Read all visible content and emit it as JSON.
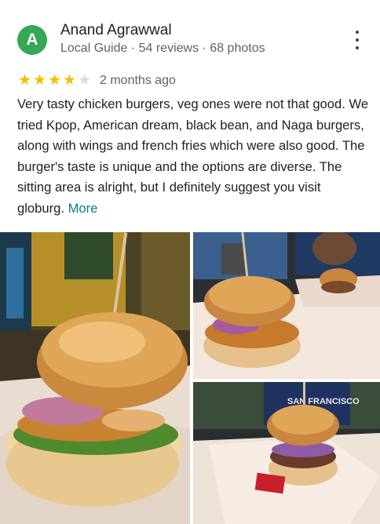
{
  "reviewer": {
    "avatar_letter": "A",
    "avatar_color": "#34a853",
    "name": "Anand Agrawwal",
    "meta": "Local Guide · 54 reviews · 68 photos"
  },
  "review": {
    "rating": 4,
    "max_rating": 5,
    "time_ago": "2 months ago",
    "text": "Very tasty chicken burgers, veg ones were not that good. We tried Kpop, American dream, black bean, and Naga burgers, along with wings and french fries which were also good. The burger's taste is unique and the options are diverse. The sitting area is alright, but I definitely suggest you visit globurg.",
    "more_label": "More"
  },
  "icons": {
    "menu": "more-vert-icon",
    "star": "star-icon"
  },
  "colors": {
    "star_filled": "#fbbc04",
    "star_empty": "#dadce0",
    "link": "#0b7a8a"
  },
  "photos": {
    "count": 3,
    "sign_text": "SAN FRANCISCO"
  }
}
